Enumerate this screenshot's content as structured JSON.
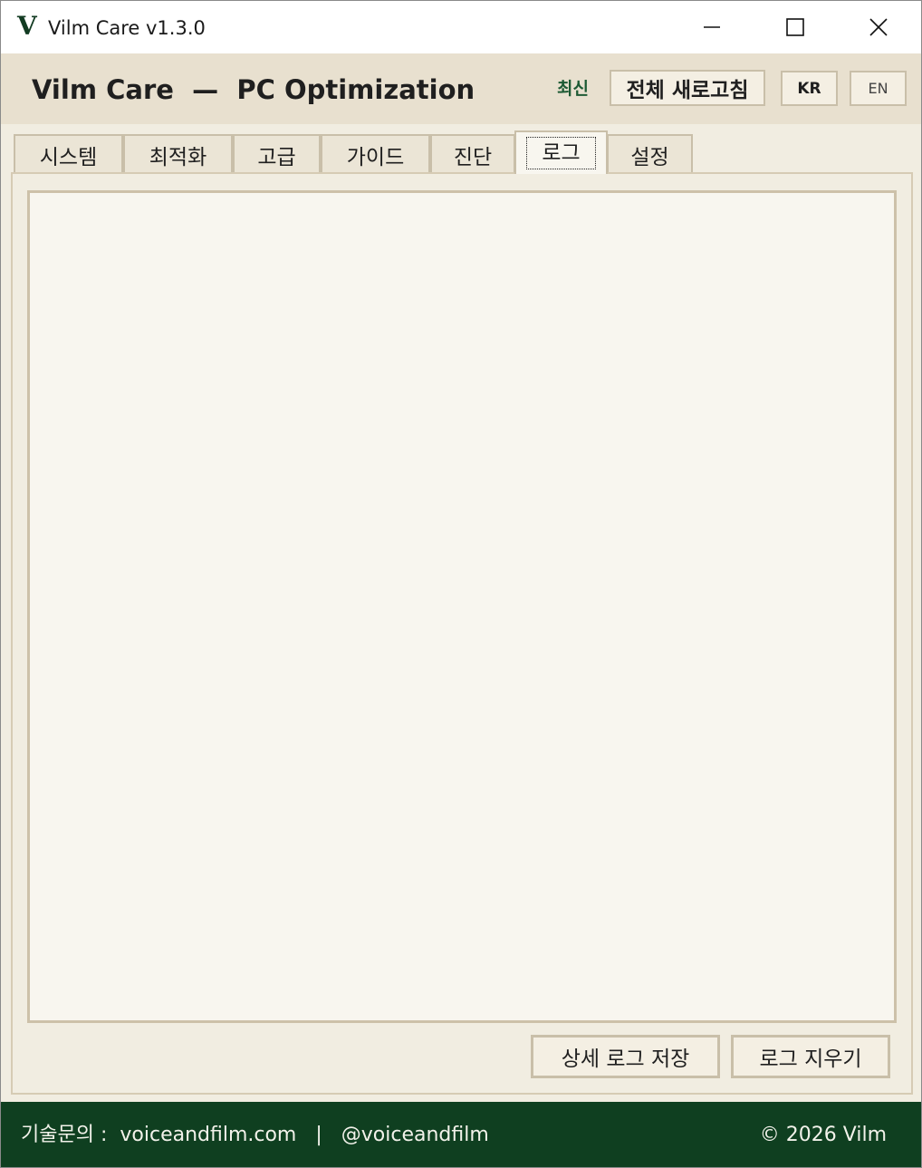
{
  "window": {
    "logo": "V",
    "title": "Vilm Care v1.3.0"
  },
  "header": {
    "title": "Vilm Care  —  PC Optimization",
    "status": "최신",
    "refresh_label": "전체 새로고침",
    "lang_kr": "KR",
    "lang_en": "EN"
  },
  "tabs": [
    {
      "label": "시스템"
    },
    {
      "label": "최적화"
    },
    {
      "label": "고급"
    },
    {
      "label": "가이드"
    },
    {
      "label": "진단"
    },
    {
      "label": "로그",
      "active": true
    },
    {
      "label": "설정"
    }
  ],
  "log": {
    "content": "",
    "save_label": "상세 로그 저장",
    "clear_label": "로그 지우기"
  },
  "footer": {
    "contact_label": "기술문의 :",
    "website": "voiceandfilm.com",
    "separator": "|",
    "handle": "@voiceandfilm",
    "copyright": "© 2026 Vilm"
  },
  "colors": {
    "brand_green": "#0f3f20",
    "header_bg": "#e8e0cf",
    "panel_bg": "#f1ede1",
    "status_green": "#1d5a34"
  }
}
